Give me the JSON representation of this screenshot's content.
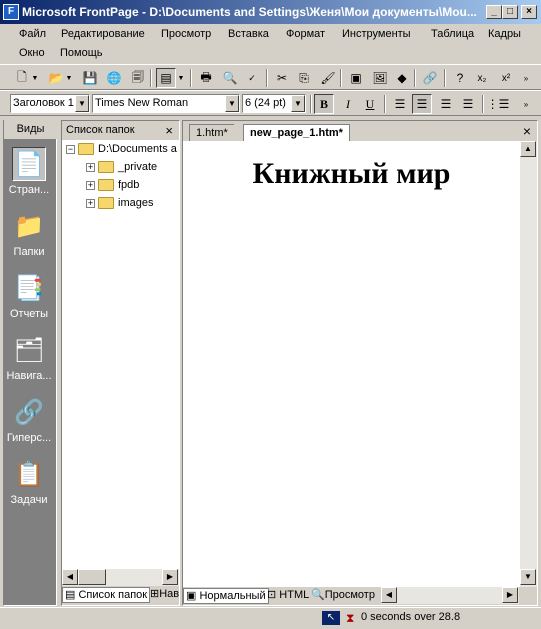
{
  "window": {
    "title": "Microsoft FrontPage - D:\\Documents and Settings\\Женя\\Мои документы\\Моu...",
    "app_icon": "frontpage-icon",
    "minimize": "_",
    "maximize": "□",
    "close": "×"
  },
  "menu": {
    "file": "Файл",
    "edit": "Редактирование",
    "view": "Просмотр",
    "insert": "Вставка",
    "format": "Формат",
    "tools": "Инструменты",
    "table": "Таблица",
    "frames": "Кадры",
    "window": "Окно",
    "help": "Помощь"
  },
  "format_bar": {
    "style": "Заголовок 1",
    "font": "Times New Roman",
    "size": "6  (24 pt)",
    "bold": "B",
    "italic": "I",
    "underline": "U"
  },
  "views": {
    "header": "Виды",
    "items": [
      {
        "label": "Стран...",
        "icon": "page-view-icon"
      },
      {
        "label": "Папки",
        "icon": "folders-icon"
      },
      {
        "label": "Отчеты",
        "icon": "reports-icon"
      },
      {
        "label": "Навига...",
        "icon": "navigation-icon"
      },
      {
        "label": "Гиперс...",
        "icon": "hyperlinks-icon"
      },
      {
        "label": "Задачи",
        "icon": "tasks-icon"
      }
    ]
  },
  "folder_list": {
    "header": "Список папок",
    "root": "D:\\Documents a",
    "children": [
      "_private",
      "fpdb",
      "images"
    ],
    "tab_folder_list": "Список папок",
    "tab_navigation": "Нав"
  },
  "editor": {
    "tabs": [
      "1.htm*",
      "new_page_1.htm*"
    ],
    "heading": "Книжный мир",
    "mode_normal": "Нормальный",
    "mode_html": "HTML",
    "mode_preview": "Просмотр"
  },
  "status": {
    "text": "0 seconds over 28.8"
  }
}
